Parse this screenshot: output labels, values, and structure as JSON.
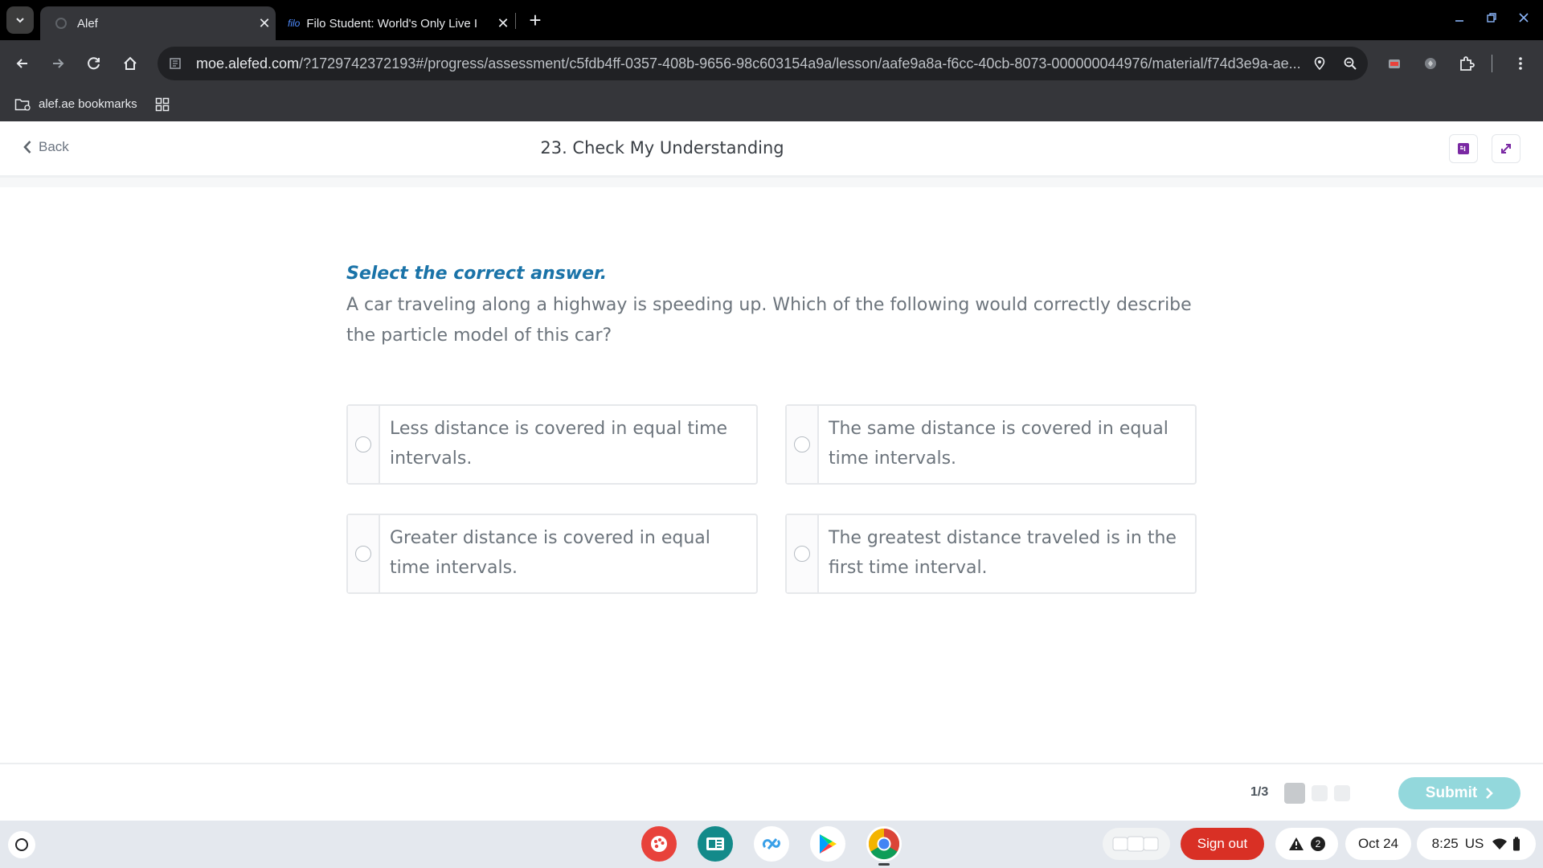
{
  "browser": {
    "tabs": [
      {
        "title": "Alef",
        "active": true
      },
      {
        "title": "Filo Student: World's Only Live I",
        "favicon_text": "filo",
        "active": false
      }
    ],
    "url_host": "moe.alefed.com",
    "url_rest": "/?1729742372193#/progress/assessment/c5fdb4ff-0357-408b-9656-98c603154a9a/lesson/aafe9a8a-f6cc-40cb-8073-000000044976/material/f74d3e9a-ae...",
    "bookmark_folder": "alef.ae bookmarks"
  },
  "header": {
    "back_label": "Back",
    "title": "23. Check My Understanding"
  },
  "question": {
    "instruction": "Select the correct answer.",
    "text": "A car traveling along a highway is speeding up. Which of the following would correctly describe the particle model of this car?",
    "options": [
      "Less distance is covered in equal time intervals.",
      "The same distance is covered in equal time intervals.",
      "Greater distance is covered in equal time intervals.",
      "The greatest distance traveled is in the first time interval."
    ]
  },
  "footer": {
    "progress": "1/3",
    "current_step": 1,
    "total_steps": 3,
    "submit_label": "Submit"
  },
  "shelf": {
    "sign_out": "Sign out",
    "notification_count": "2",
    "date": "Oct 24",
    "time": "8:25",
    "locale": "US"
  },
  "colors": {
    "accent": "#1a73a8",
    "submit_bg": "#93d8dc",
    "sign_out_bg": "#d93025"
  }
}
